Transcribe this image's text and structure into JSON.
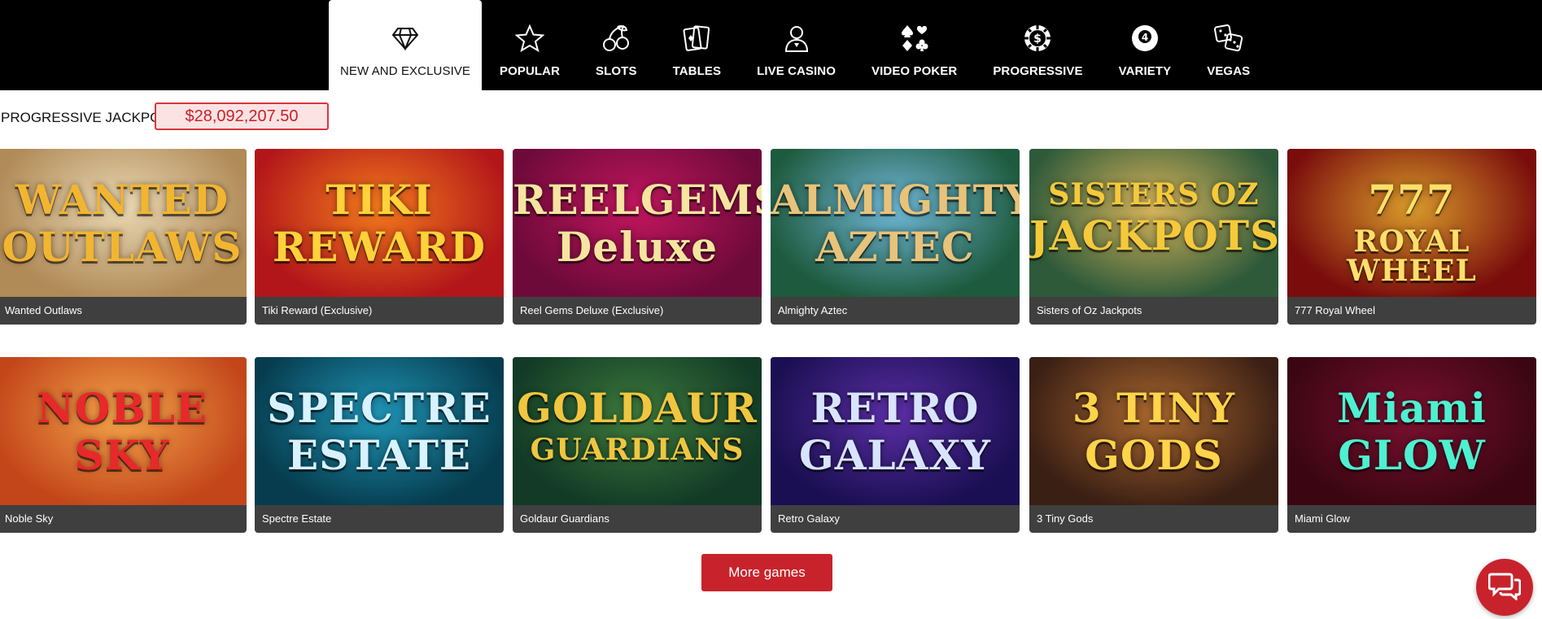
{
  "nav": {
    "tabs": [
      {
        "label": "NEW AND EXCLUSIVE",
        "icon": "diamond-icon",
        "active": true
      },
      {
        "label": "POPULAR",
        "icon": "star-icon"
      },
      {
        "label": "SLOTS",
        "icon": "cherries-icon"
      },
      {
        "label": "TABLES",
        "icon": "playing-cards-icon"
      },
      {
        "label": "LIVE CASINO",
        "icon": "dealer-icon"
      },
      {
        "label": "VIDEO POKER",
        "icon": "card-suits-icon"
      },
      {
        "label": "PROGRESSIVE",
        "icon": "poker-chip-icon"
      },
      {
        "label": "VARIETY",
        "icon": "billiard-ball-icon"
      },
      {
        "label": "VEGAS",
        "icon": "dice-icon"
      }
    ]
  },
  "jackpot": {
    "label": "PROGRESSIVE JACKPOT",
    "value": "$28,092,207.50"
  },
  "games": [
    {
      "name": "Wanted Outlaws",
      "art": [
        "WANTED",
        "OUTLAWS"
      ],
      "bg": "#b08a57",
      "bg2": "#e9d7b2",
      "artColor": "#f2b531"
    },
    {
      "name": "Tiki Reward (Exclusive)",
      "art": [
        "TIKI",
        "REWARD"
      ],
      "bg": "#b3161a",
      "bg2": "#f27a1c",
      "artColor": "#ffd23a"
    },
    {
      "name": "Reel Gems Deluxe (Exclusive)",
      "art": [
        "REELGEMS",
        "Deluxe"
      ],
      "bg": "#6e0a3a",
      "bg2": "#c2165e",
      "artColor": "#f6e4a0"
    },
    {
      "name": "Almighty Aztec",
      "art": [
        "ALMIGHTY",
        "AZTEC"
      ],
      "bg": "#1e5a3d",
      "bg2": "#6fb7d8",
      "artColor": "#e8c37a"
    },
    {
      "name": "Sisters of Oz Jackpots",
      "art": [
        "SISTERS OZ",
        "JACKPOTS"
      ],
      "bg": "#2e5a3a",
      "bg2": "#d7b45a",
      "artColor": "#f5c93a"
    },
    {
      "name": "777 Royal Wheel",
      "art": [
        "777",
        "ROYAL WHEEL"
      ],
      "bg": "#7a0c0c",
      "bg2": "#d89a2a",
      "artColor": "#ffdf6a"
    },
    {
      "name": "Noble Sky",
      "art": [
        "NOBLE",
        "SKY"
      ],
      "bg": "#c3461a",
      "bg2": "#f3a34a",
      "artColor": "#e9282a"
    },
    {
      "name": "Spectre Estate",
      "art": [
        "SPECTRE",
        "ESTATE"
      ],
      "bg": "#063c4e",
      "bg2": "#1f94b5",
      "artColor": "#d8f2ff"
    },
    {
      "name": "Goldaur Guardians",
      "art": [
        "GOLDAUR",
        "GUARDIANS"
      ],
      "bg": "#123a26",
      "bg2": "#3d7a3b",
      "artColor": "#f0c640"
    },
    {
      "name": "Retro Galaxy",
      "art": [
        "RETRO",
        "GALAXY"
      ],
      "bg": "#1a0f52",
      "bg2": "#5b2ea5",
      "artColor": "#d8e4ff"
    },
    {
      "name": "3 Tiny Gods",
      "art": [
        "3 TINY",
        "GODS"
      ],
      "bg": "#3a1f14",
      "bg2": "#a8662e",
      "artColor": "#ffd34a"
    },
    {
      "name": "Miami Glow",
      "art": [
        "Miami",
        "GLOW"
      ],
      "bg": "#3b0612",
      "bg2": "#7a1030",
      "artColor": "#4ef0d2"
    }
  ],
  "more_button": "More games",
  "chat": {
    "icon": "chat-bubbles-icon"
  },
  "colors": {
    "accent": "#c8232c",
    "nav_bg": "#000000",
    "card_bg": "#3f3f3f"
  }
}
